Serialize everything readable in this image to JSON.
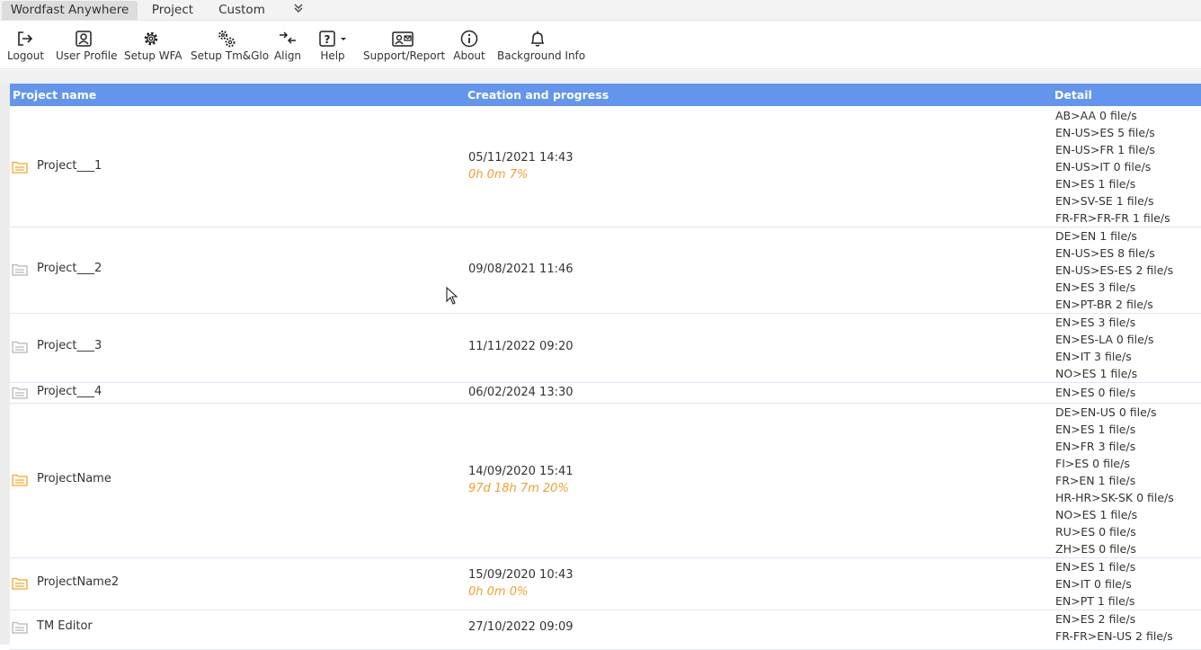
{
  "tabs": [
    {
      "label": "Wordfast Anywhere",
      "active": true
    },
    {
      "label": "Project",
      "active": false
    },
    {
      "label": "Custom",
      "active": false
    }
  ],
  "tabs_more_icon": "double-chevron-down-icon",
  "toolbar": [
    {
      "label": "Logout",
      "icon": "logout-icon"
    },
    {
      "label": "User Profile",
      "icon": "user-profile-icon"
    },
    {
      "label": "Setup WFA",
      "icon": "gear-icon"
    },
    {
      "label": "Setup Tm&Glo",
      "icon": "gears-icon"
    },
    {
      "label": "Align",
      "icon": "align-icon"
    },
    {
      "label": "Help",
      "icon": "help-icon"
    },
    {
      "label": "Support/Report",
      "icon": "support-report-icon"
    },
    {
      "label": "About",
      "icon": "info-icon"
    },
    {
      "label": "Background Info",
      "icon": "bell-icon"
    }
  ],
  "table": {
    "headers": [
      "Project name",
      "Creation and progress",
      "Detail"
    ],
    "rows": [
      {
        "name": "Project___1",
        "folder": "open",
        "date": "05/11/2021 14:43",
        "progress": "0h 0m 7%",
        "details": [
          "AB>AA 0 file/s",
          "EN-US>ES 5 file/s",
          "EN-US>FR 1 file/s",
          "EN-US>IT 0 file/s",
          "EN>ES 1 file/s",
          "EN>SV-SE 1 file/s",
          "FR-FR>FR-FR 1 file/s"
        ]
      },
      {
        "name": "Project___2",
        "folder": "closed",
        "date": "09/08/2021 11:46",
        "progress": "",
        "details": [
          "DE>EN 1 file/s",
          "EN-US>ES 8 file/s",
          "EN-US>ES-ES 2 file/s",
          "EN>ES 3 file/s",
          "EN>PT-BR 2 file/s"
        ]
      },
      {
        "name": "Project___3",
        "folder": "closed",
        "date": "11/11/2022 09:20",
        "progress": "",
        "details": [
          "EN>ES 3 file/s",
          "EN>ES-LA 0 file/s",
          "EN>IT 3 file/s",
          "NO>ES 1 file/s"
        ]
      },
      {
        "name": "Project___4",
        "folder": "closed",
        "date": "06/02/2024 13:30",
        "progress": "",
        "details": [
          "EN>ES 0 file/s"
        ]
      },
      {
        "name": "ProjectName",
        "folder": "open",
        "date": "14/09/2020 15:41",
        "progress": "97d 18h 7m 20%",
        "details": [
          "DE>EN-US 0 file/s",
          "EN>ES 1 file/s",
          "EN>FR 3 file/s",
          "FI>ES 0 file/s",
          "FR>EN 1 file/s",
          "HR-HR>SK-SK 0 file/s",
          "NO>ES 1 file/s",
          "RU>ES 0 file/s",
          "ZH>ES 0 file/s"
        ]
      },
      {
        "name": "ProjectName2",
        "folder": "open",
        "date": "15/09/2020 10:43",
        "progress": "0h 0m 0%",
        "details": [
          "EN>ES 1 file/s",
          "EN>IT 0 file/s",
          "EN>PT 1 file/s"
        ]
      },
      {
        "name": "TM Editor",
        "folder": "closed",
        "date": "27/10/2022 09:09",
        "progress": "",
        "details": [
          "EN>ES 2 file/s",
          "FR-FR>EN-US 2 file/s"
        ]
      }
    ]
  },
  "colors": {
    "header_bg": "#6495ed",
    "progress": "#f0a030",
    "folder_open": "#f5a623",
    "folder_closed": "#b5b5b5"
  }
}
